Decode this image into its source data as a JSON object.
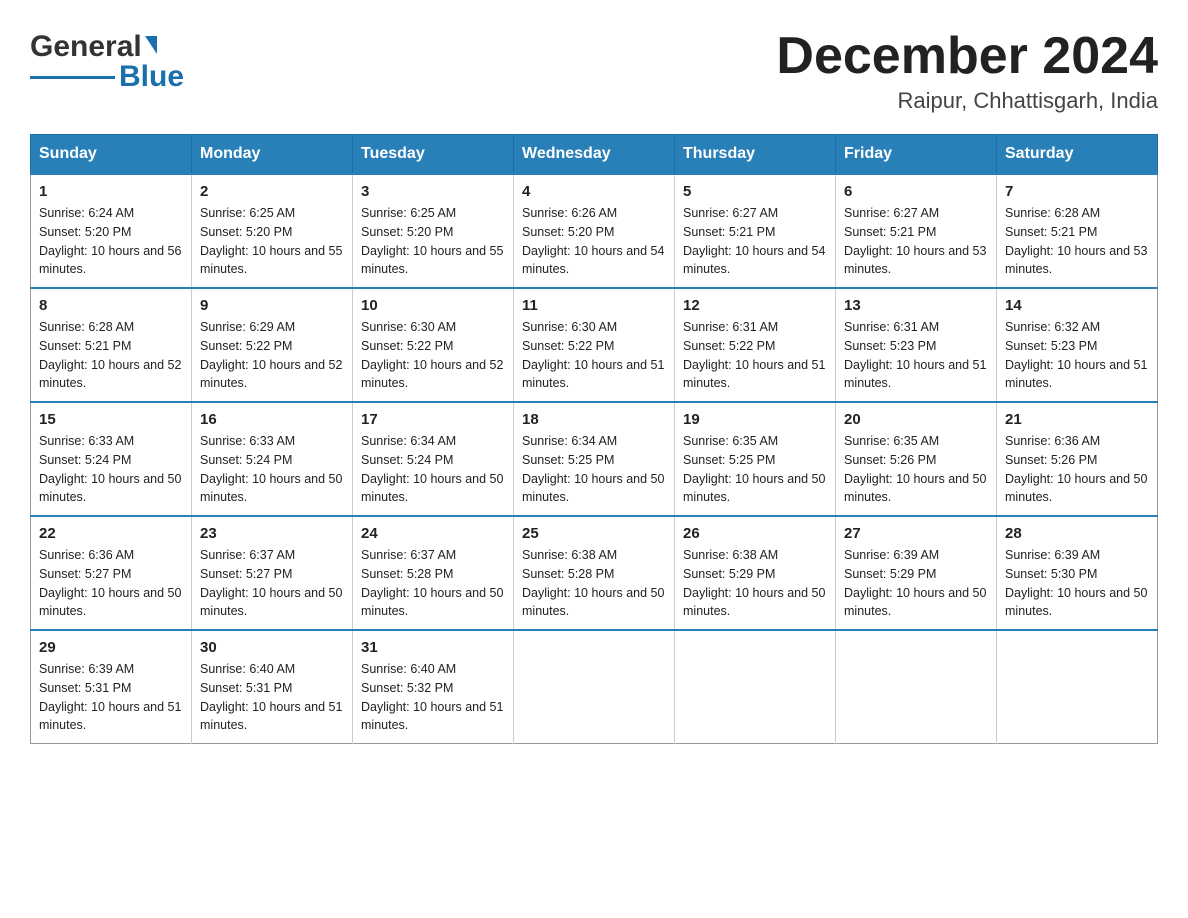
{
  "header": {
    "logo_general": "General",
    "logo_blue": "Blue",
    "month_year": "December 2024",
    "location": "Raipur, Chhattisgarh, India"
  },
  "calendar": {
    "days_of_week": [
      "Sunday",
      "Monday",
      "Tuesday",
      "Wednesday",
      "Thursday",
      "Friday",
      "Saturday"
    ],
    "weeks": [
      [
        {
          "day": "1",
          "sunrise": "6:24 AM",
          "sunset": "5:20 PM",
          "daylight": "10 hours and 56 minutes."
        },
        {
          "day": "2",
          "sunrise": "6:25 AM",
          "sunset": "5:20 PM",
          "daylight": "10 hours and 55 minutes."
        },
        {
          "day": "3",
          "sunrise": "6:25 AM",
          "sunset": "5:20 PM",
          "daylight": "10 hours and 55 minutes."
        },
        {
          "day": "4",
          "sunrise": "6:26 AM",
          "sunset": "5:20 PM",
          "daylight": "10 hours and 54 minutes."
        },
        {
          "day": "5",
          "sunrise": "6:27 AM",
          "sunset": "5:21 PM",
          "daylight": "10 hours and 54 minutes."
        },
        {
          "day": "6",
          "sunrise": "6:27 AM",
          "sunset": "5:21 PM",
          "daylight": "10 hours and 53 minutes."
        },
        {
          "day": "7",
          "sunrise": "6:28 AM",
          "sunset": "5:21 PM",
          "daylight": "10 hours and 53 minutes."
        }
      ],
      [
        {
          "day": "8",
          "sunrise": "6:28 AM",
          "sunset": "5:21 PM",
          "daylight": "10 hours and 52 minutes."
        },
        {
          "day": "9",
          "sunrise": "6:29 AM",
          "sunset": "5:22 PM",
          "daylight": "10 hours and 52 minutes."
        },
        {
          "day": "10",
          "sunrise": "6:30 AM",
          "sunset": "5:22 PM",
          "daylight": "10 hours and 52 minutes."
        },
        {
          "day": "11",
          "sunrise": "6:30 AM",
          "sunset": "5:22 PM",
          "daylight": "10 hours and 51 minutes."
        },
        {
          "day": "12",
          "sunrise": "6:31 AM",
          "sunset": "5:22 PM",
          "daylight": "10 hours and 51 minutes."
        },
        {
          "day": "13",
          "sunrise": "6:31 AM",
          "sunset": "5:23 PM",
          "daylight": "10 hours and 51 minutes."
        },
        {
          "day": "14",
          "sunrise": "6:32 AM",
          "sunset": "5:23 PM",
          "daylight": "10 hours and 51 minutes."
        }
      ],
      [
        {
          "day": "15",
          "sunrise": "6:33 AM",
          "sunset": "5:24 PM",
          "daylight": "10 hours and 50 minutes."
        },
        {
          "day": "16",
          "sunrise": "6:33 AM",
          "sunset": "5:24 PM",
          "daylight": "10 hours and 50 minutes."
        },
        {
          "day": "17",
          "sunrise": "6:34 AM",
          "sunset": "5:24 PM",
          "daylight": "10 hours and 50 minutes."
        },
        {
          "day": "18",
          "sunrise": "6:34 AM",
          "sunset": "5:25 PM",
          "daylight": "10 hours and 50 minutes."
        },
        {
          "day": "19",
          "sunrise": "6:35 AM",
          "sunset": "5:25 PM",
          "daylight": "10 hours and 50 minutes."
        },
        {
          "day": "20",
          "sunrise": "6:35 AM",
          "sunset": "5:26 PM",
          "daylight": "10 hours and 50 minutes."
        },
        {
          "day": "21",
          "sunrise": "6:36 AM",
          "sunset": "5:26 PM",
          "daylight": "10 hours and 50 minutes."
        }
      ],
      [
        {
          "day": "22",
          "sunrise": "6:36 AM",
          "sunset": "5:27 PM",
          "daylight": "10 hours and 50 minutes."
        },
        {
          "day": "23",
          "sunrise": "6:37 AM",
          "sunset": "5:27 PM",
          "daylight": "10 hours and 50 minutes."
        },
        {
          "day": "24",
          "sunrise": "6:37 AM",
          "sunset": "5:28 PM",
          "daylight": "10 hours and 50 minutes."
        },
        {
          "day": "25",
          "sunrise": "6:38 AM",
          "sunset": "5:28 PM",
          "daylight": "10 hours and 50 minutes."
        },
        {
          "day": "26",
          "sunrise": "6:38 AM",
          "sunset": "5:29 PM",
          "daylight": "10 hours and 50 minutes."
        },
        {
          "day": "27",
          "sunrise": "6:39 AM",
          "sunset": "5:29 PM",
          "daylight": "10 hours and 50 minutes."
        },
        {
          "day": "28",
          "sunrise": "6:39 AM",
          "sunset": "5:30 PM",
          "daylight": "10 hours and 50 minutes."
        }
      ],
      [
        {
          "day": "29",
          "sunrise": "6:39 AM",
          "sunset": "5:31 PM",
          "daylight": "10 hours and 51 minutes."
        },
        {
          "day": "30",
          "sunrise": "6:40 AM",
          "sunset": "5:31 PM",
          "daylight": "10 hours and 51 minutes."
        },
        {
          "day": "31",
          "sunrise": "6:40 AM",
          "sunset": "5:32 PM",
          "daylight": "10 hours and 51 minutes."
        },
        null,
        null,
        null,
        null
      ]
    ]
  }
}
